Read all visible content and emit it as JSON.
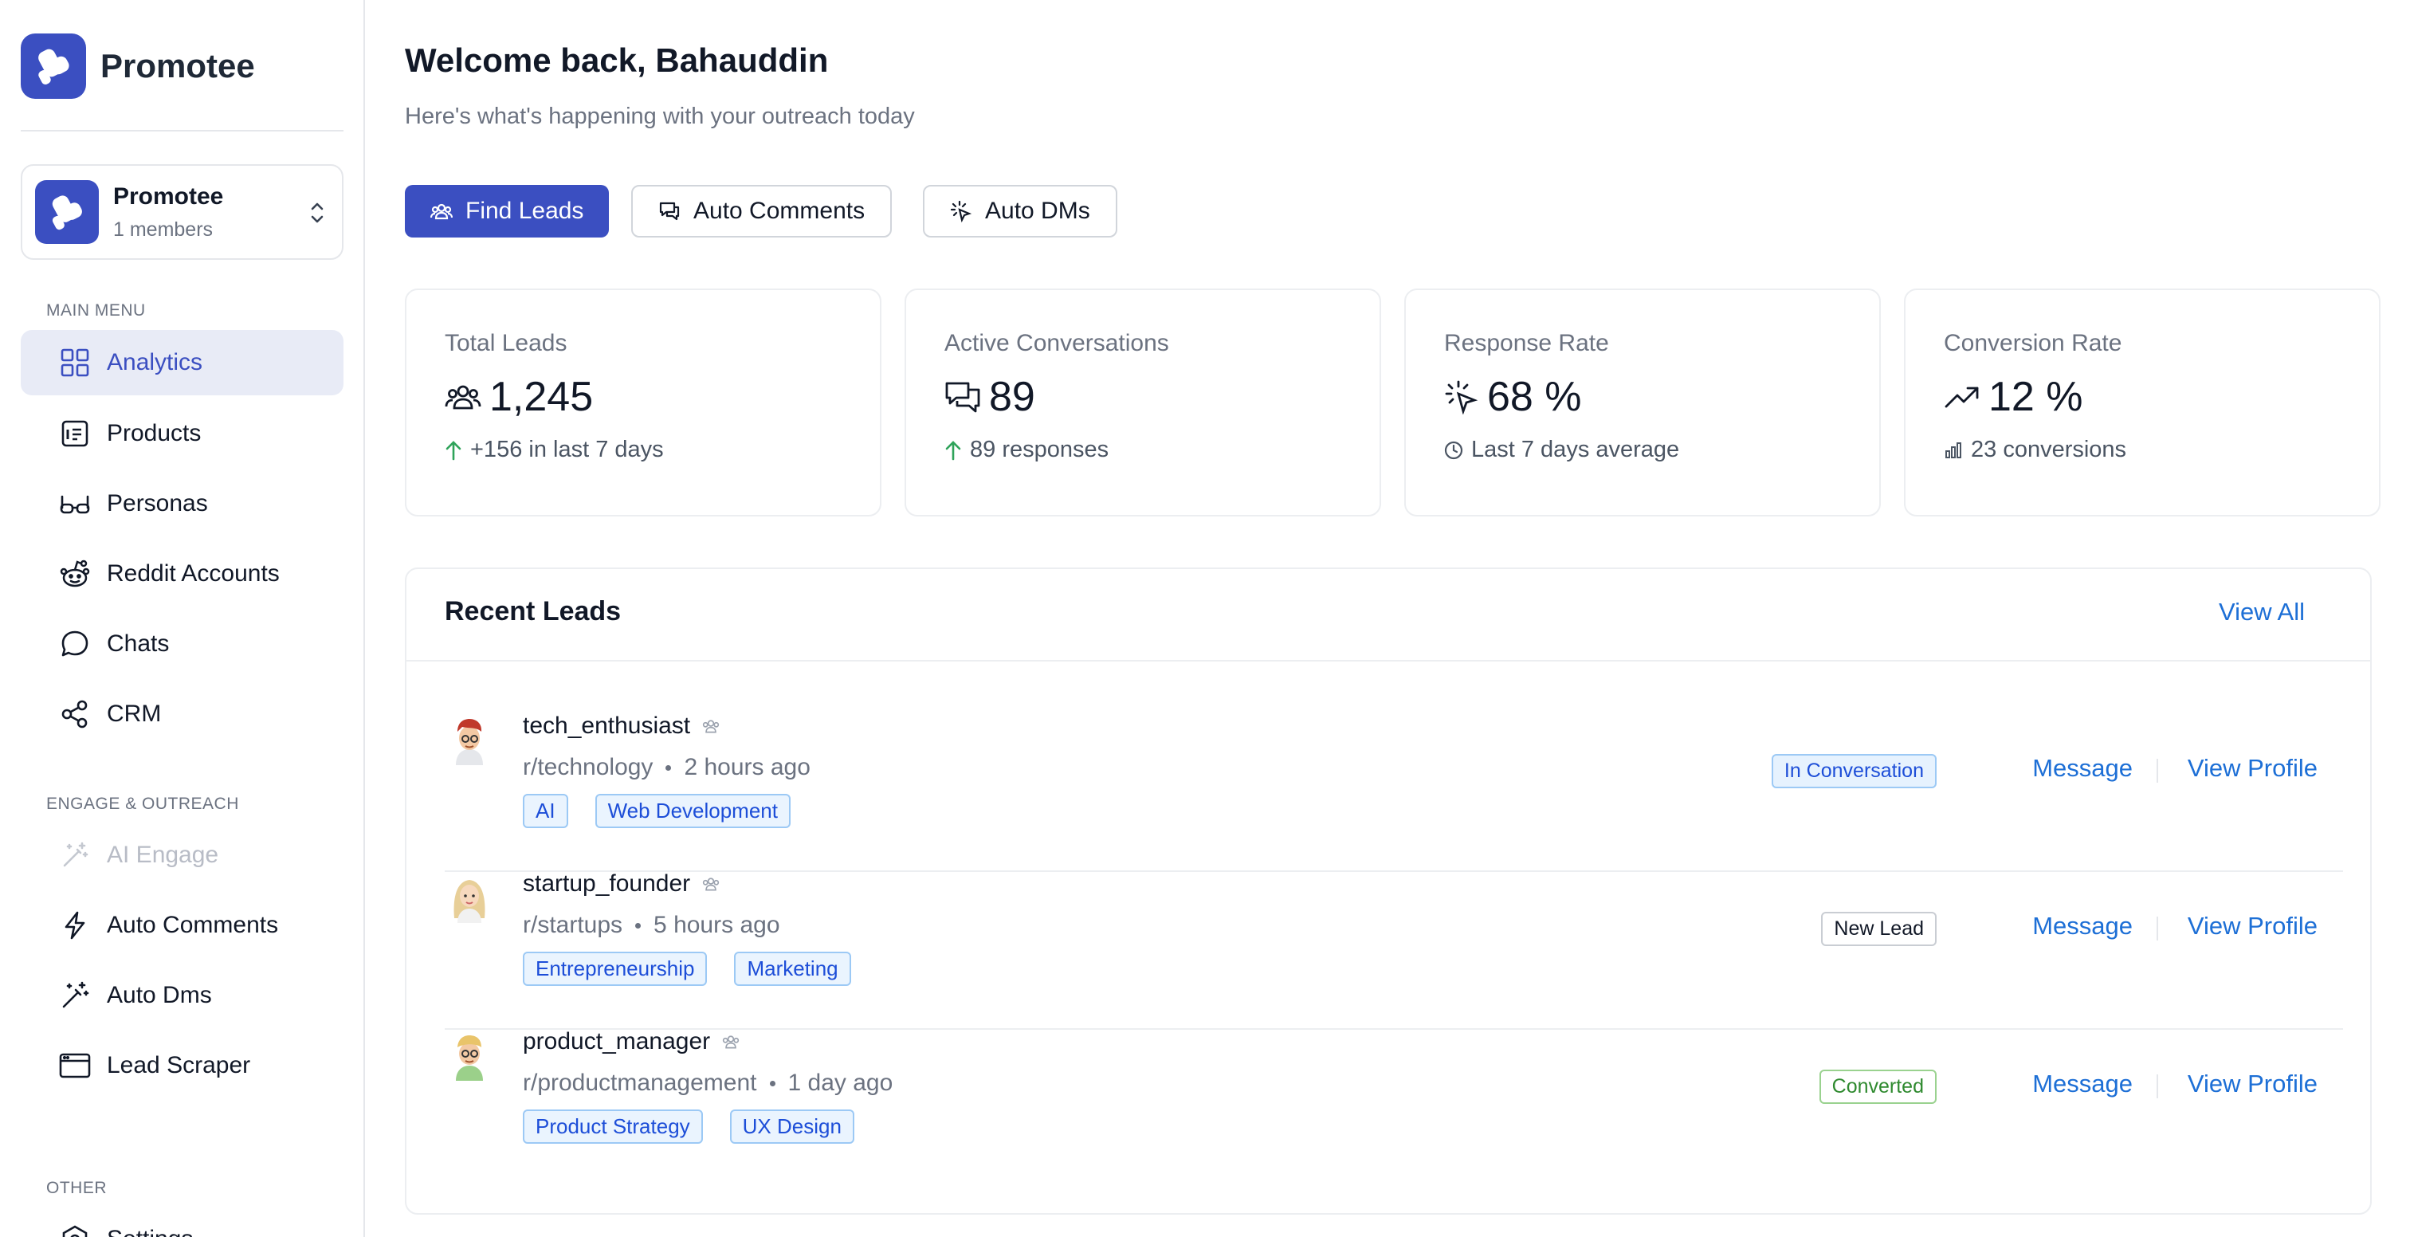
{
  "app": {
    "name": "Promotee",
    "brand_color": "#3b4fc1",
    "workspace": {
      "name": "Promotee",
      "members": "1 members"
    }
  },
  "sidebar": {
    "sections": [
      {
        "label": "MAIN MENU",
        "items": [
          {
            "label": "Analytics",
            "icon": "grid-icon",
            "active": true
          },
          {
            "label": "Products",
            "icon": "product-icon"
          },
          {
            "label": "Personas",
            "icon": "glasses-icon"
          },
          {
            "label": "Reddit Accounts",
            "icon": "reddit-icon"
          },
          {
            "label": "Chats",
            "icon": "chat-bubble-icon"
          },
          {
            "label": "CRM",
            "icon": "share-nodes-icon"
          }
        ]
      },
      {
        "label": "ENGAGE & OUTREACH",
        "items": [
          {
            "label": "AI Engage",
            "icon": "magic-wand-icon",
            "disabled": true
          },
          {
            "label": "Auto Comments",
            "icon": "lightning-icon"
          },
          {
            "label": "Auto Dms",
            "icon": "wand-sparkle-icon"
          },
          {
            "label": "Lead Scraper",
            "icon": "browser-window-icon"
          }
        ]
      },
      {
        "label": "OTHER",
        "items": [
          {
            "label": "Settings",
            "icon": "settings-icon"
          }
        ]
      }
    ]
  },
  "header": {
    "welcome": "Welcome back, Bahauddin",
    "subtitle": "Here's what's happening with your outreach today"
  },
  "actions": {
    "find_leads": "Find Leads",
    "auto_comments": "Auto Comments",
    "auto_dms": "Auto DMs"
  },
  "stats": [
    {
      "title": "Total Leads",
      "value": "1,245",
      "icon": "users-icon",
      "footer": "+156 in last 7 days",
      "footer_icon": "arrow-up-icon"
    },
    {
      "title": "Active Conversations",
      "value": "89",
      "icon": "chat-bubbles-icon",
      "footer": "89 responses",
      "footer_icon": "arrow-up-icon"
    },
    {
      "title": "Response Rate",
      "value": "68 %",
      "icon": "cursor-click-icon",
      "footer": "Last 7 days average",
      "footer_icon": "clock-icon"
    },
    {
      "title": "Conversion Rate",
      "value": "12 %",
      "icon": "trend-up-icon",
      "footer": "23 conversions",
      "footer_icon": "bar-chart-icon"
    }
  ],
  "recent_leads": {
    "title": "Recent Leads",
    "view_all": "View All",
    "message_label": "Message",
    "view_profile_label": "View Profile",
    "rows": [
      {
        "username": "tech_enthusiast",
        "subreddit": "r/technology",
        "time": "2 hours ago",
        "tags": [
          "AI",
          "Web Development"
        ],
        "status": "In Conversation"
      },
      {
        "username": "startup_founder",
        "subreddit": "r/startups",
        "time": "5 hours ago",
        "tags": [
          "Entrepreneurship",
          "Marketing"
        ],
        "status": "New Lead"
      },
      {
        "username": "product_manager",
        "subreddit": "r/productmanagement",
        "time": "1 day ago",
        "tags": [
          "Product Strategy",
          "UX Design"
        ],
        "status": "Converted"
      }
    ]
  }
}
